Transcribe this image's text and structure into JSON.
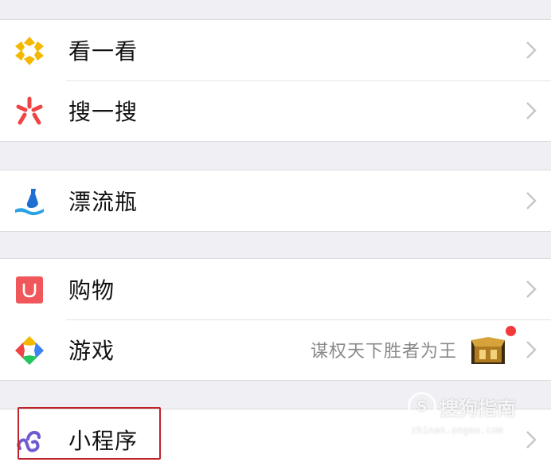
{
  "menu": {
    "group1": [
      {
        "label": "看一看",
        "icon": "kan-yi-kan-icon"
      },
      {
        "label": "搜一搜",
        "icon": "sou-yi-sou-icon"
      }
    ],
    "group2": [
      {
        "label": "漂流瓶",
        "icon": "drift-bottle-icon"
      }
    ],
    "group3": [
      {
        "label": "购物",
        "icon": "shopping-bag-icon"
      },
      {
        "label": "游戏",
        "icon": "games-icon",
        "subtitle": "谋权天下胜者为王",
        "has_badge": true
      }
    ],
    "group4": [
      {
        "label": "小程序",
        "icon": "mini-program-icon"
      }
    ]
  },
  "watermark": {
    "text": "搜狗指南",
    "logo": "S",
    "url": "zhinan.sogou.com"
  },
  "colors": {
    "background": "#efeff4",
    "highlight": "#c0222a",
    "badge": "#f33a3a"
  }
}
